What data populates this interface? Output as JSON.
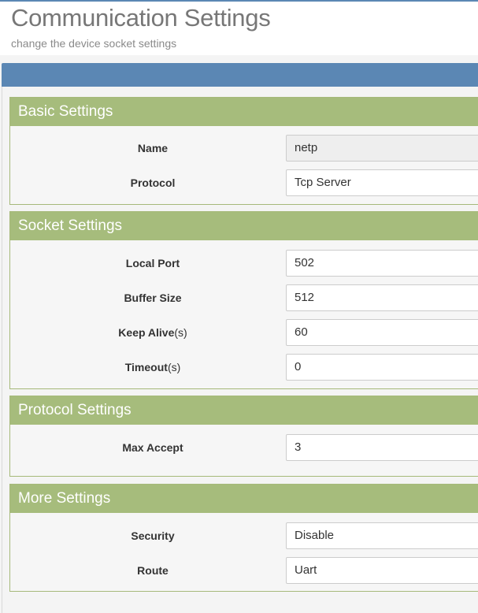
{
  "header": {
    "title": "Communication Settings",
    "subtitle": "change the device socket settings"
  },
  "colors": {
    "accent": "#5b87b4",
    "panel_heading": "#a6bc7c",
    "panel_border": "#a6b97a"
  },
  "basic": {
    "heading": "Basic Settings",
    "name_label": "Name",
    "name_value": "netp",
    "protocol_label": "Protocol",
    "protocol_value": "Tcp Server"
  },
  "socket": {
    "heading": "Socket Settings",
    "local_port_label": "Local Port",
    "local_port_value": "502",
    "buffer_size_label": "Buffer Size",
    "buffer_size_value": "512",
    "keep_alive_label": "Keep Alive",
    "keep_alive_unit": "(s)",
    "keep_alive_value": "60",
    "timeout_label": "Timeout",
    "timeout_unit": "(s)",
    "timeout_value": "0"
  },
  "protocol_settings": {
    "heading": "Protocol Settings",
    "max_accept_label": "Max Accept",
    "max_accept_value": "3"
  },
  "more": {
    "heading": "More Settings",
    "security_label": "Security",
    "security_value": "Disable",
    "route_label": "Route",
    "route_value": "Uart"
  }
}
